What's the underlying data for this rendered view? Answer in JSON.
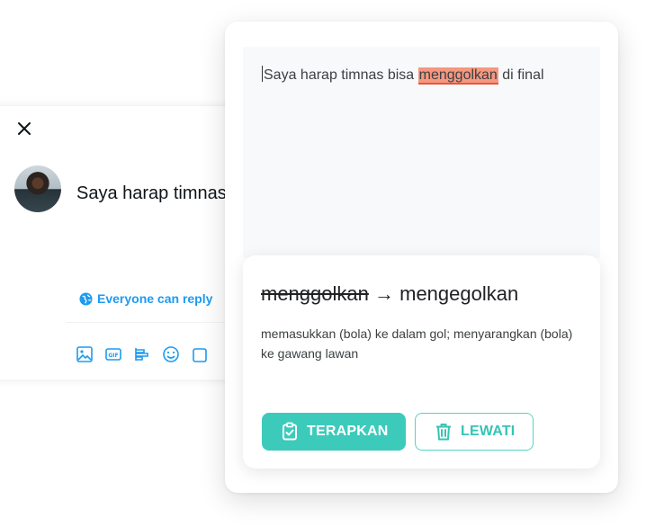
{
  "composer": {
    "tweet_text": "Saya harap timnas bisa menggolkan di final",
    "reply_setting": "Everyone can reply",
    "toolbar_icons": [
      "image-icon",
      "gif-icon",
      "poll-icon",
      "emoji-icon",
      "schedule-icon"
    ]
  },
  "editor": {
    "before": "Saya harap timnas bisa ",
    "flagged": "menggolkan",
    "after": " di final"
  },
  "suggestion": {
    "original": "menggolkan",
    "arrow": "→",
    "replacement": "mengegolkan",
    "definition": "memasukkan (bola) ke dalam gol; menyarangkan (bola) ke gawang lawan",
    "apply_label": "TERAPKAN",
    "skip_label": "LEWATI"
  },
  "colors": {
    "accent": "#3ccabb",
    "highlight": "#f6977f",
    "twitter_blue": "#1d9bf0"
  }
}
